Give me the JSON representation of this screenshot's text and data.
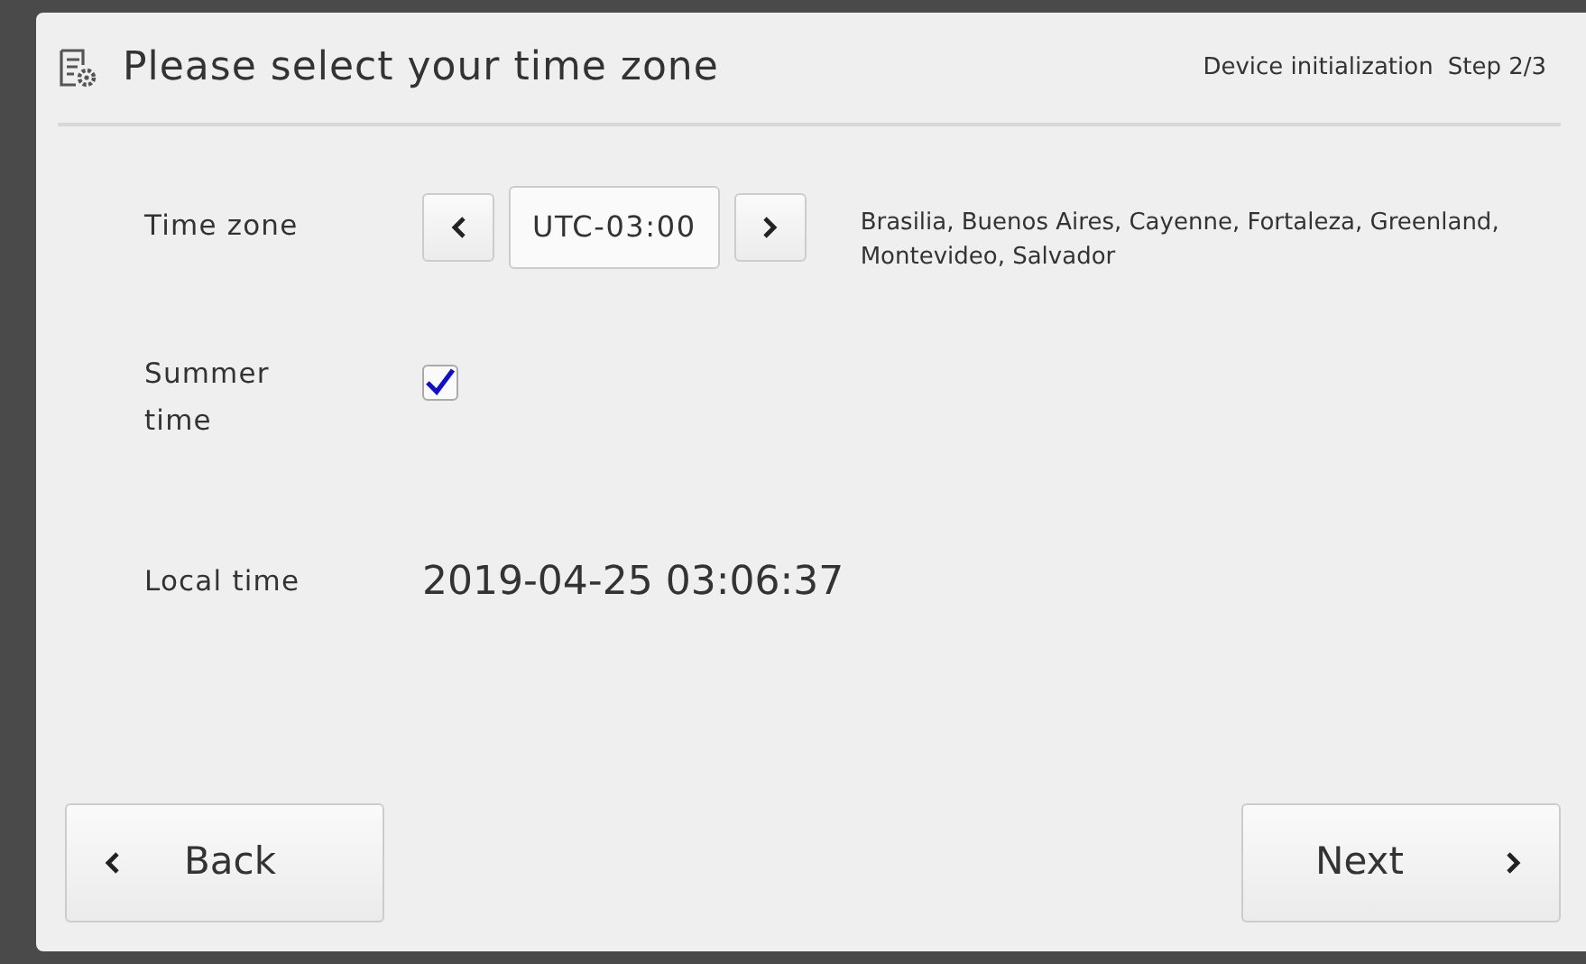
{
  "header": {
    "title": "Please select your time zone",
    "context": "Device initialization",
    "step": "Step 2/3"
  },
  "time_zone": {
    "label": "Time zone",
    "value": "UTC-03:00",
    "cities": "Brasilia, Buenos Aires, Cayenne, Fortaleza, Greenland, Montevideo, Salvador"
  },
  "summer_time": {
    "label": "Summer time",
    "checked": true
  },
  "local_time": {
    "label": "Local time",
    "value": "2019-04-25 03:06:37"
  },
  "buttons": [
    {
      "kind": "back",
      "label": "Back"
    },
    {
      "kind": "next",
      "label": "Next"
    }
  ]
}
